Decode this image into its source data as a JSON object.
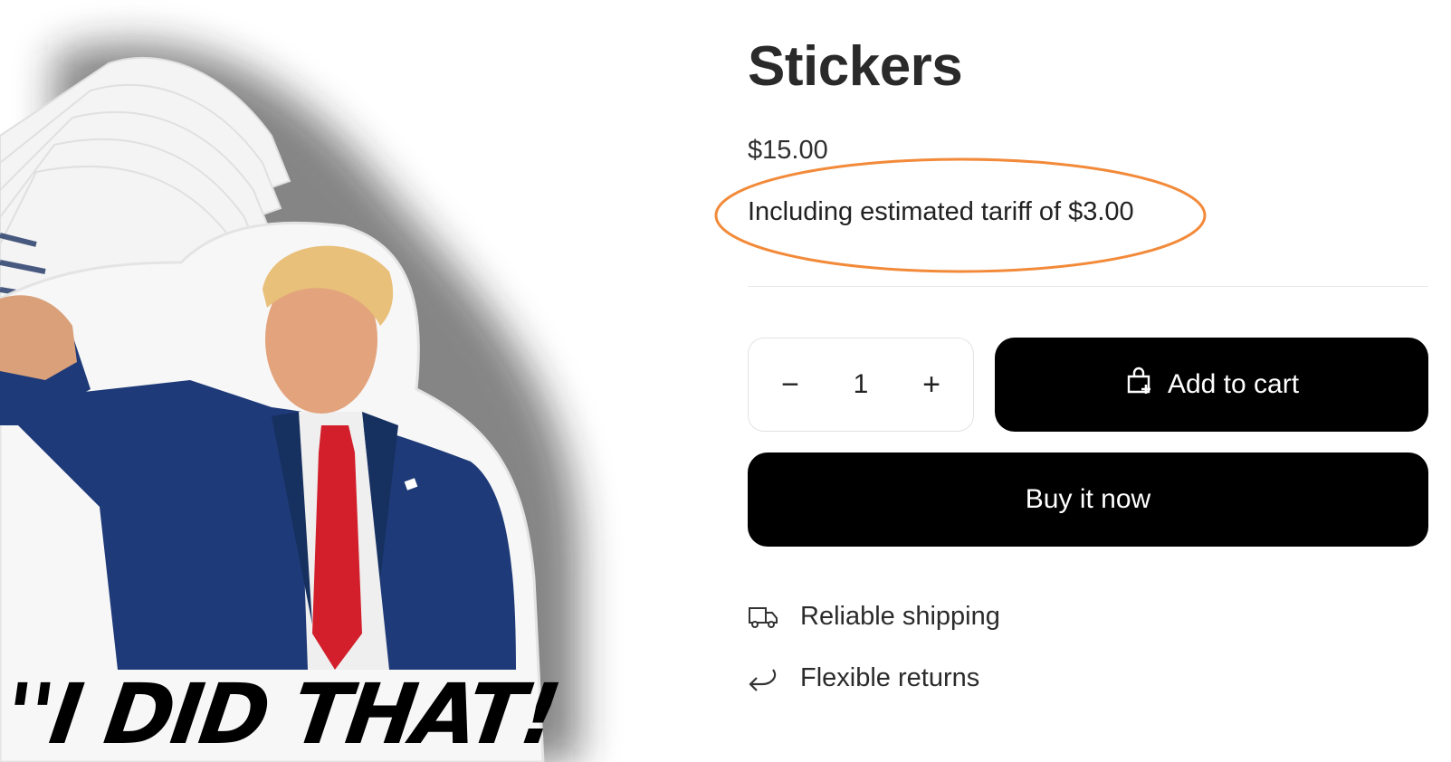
{
  "product": {
    "title": "Stickers",
    "price": "$15.00",
    "tariff_note": "Including estimated tariff of $3.00",
    "quantity": "1",
    "image_caption": "''I DID THAT!"
  },
  "actions": {
    "add_to_cart_label": "Add to cart",
    "buy_now_label": "Buy it now",
    "decrease_symbol": "−",
    "increase_symbol": "+"
  },
  "features": [
    {
      "icon": "truck-icon",
      "label": "Reliable shipping"
    },
    {
      "icon": "return-arrow-icon",
      "label": "Flexible returns"
    }
  ],
  "colors": {
    "highlight": "#f28a3a",
    "button_bg": "#000000",
    "button_text": "#ffffff",
    "suit": "#1e3a78",
    "tie": "#d21f2b"
  }
}
